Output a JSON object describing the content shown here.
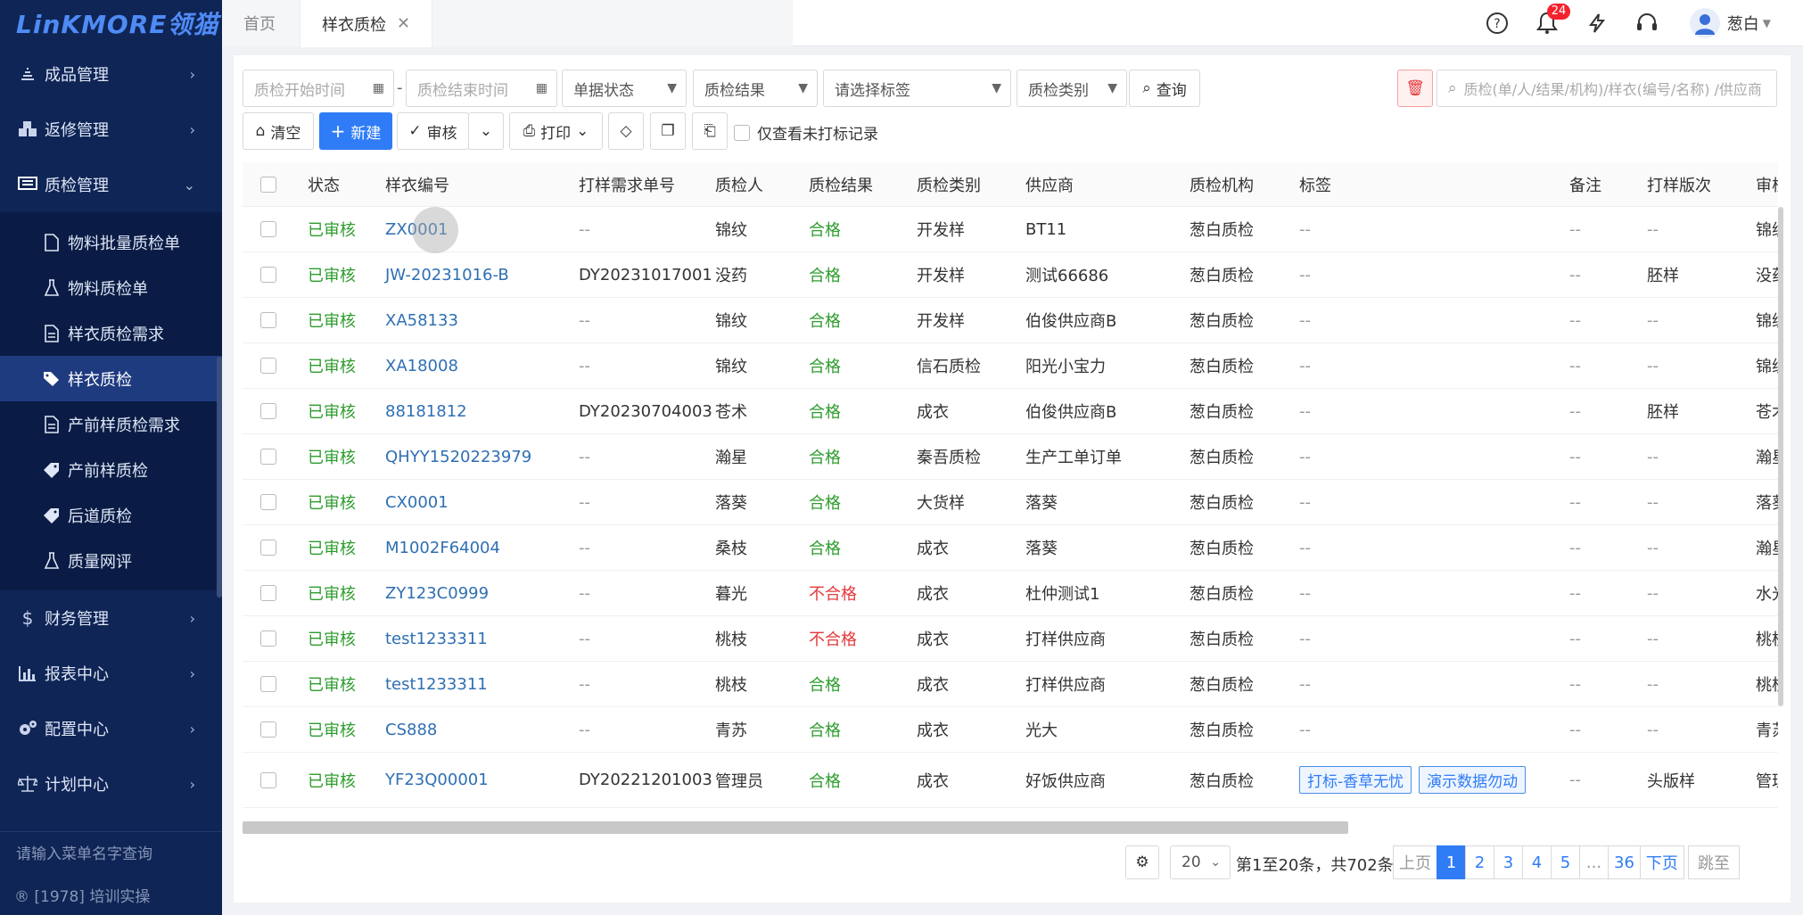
{
  "sidebar": {
    "logo": "LinKMORE领猫",
    "menu_top": [
      {
        "label": "成品管理",
        "icon": "stack-icon"
      },
      {
        "label": "返修管理",
        "icon": "cubes-icon"
      },
      {
        "label": "质检管理",
        "icon": "monitor-icon"
      }
    ],
    "submenu": [
      {
        "label": "物料批量质检单",
        "icon": "document-icon"
      },
      {
        "label": "物料质检单",
        "icon": "flask-icon"
      },
      {
        "label": "样衣质检需求",
        "icon": "document-list-icon"
      },
      {
        "label": "样衣质检",
        "icon": "tags-icon",
        "active": true
      },
      {
        "label": "产前样质检需求",
        "icon": "document-list-icon"
      },
      {
        "label": "产前样质检",
        "icon": "tag-icon"
      },
      {
        "label": "后道质检",
        "icon": "tag-icon"
      },
      {
        "label": "质量网评",
        "icon": "flask-icon"
      }
    ],
    "menu_bottom": [
      {
        "label": "财务管理",
        "icon": "dollar-icon"
      },
      {
        "label": "报表中心",
        "icon": "bar-chart-icon"
      },
      {
        "label": "配置中心",
        "icon": "gears-icon"
      },
      {
        "label": "计划中心",
        "icon": "scale-icon"
      }
    ],
    "menu_search_placeholder": "请输入菜单名字查询",
    "footer": "® [1978] 培训实操"
  },
  "header": {
    "tab_home": "首页",
    "tab_current": "样衣质检",
    "notification_count": "24",
    "username": "葱白"
  },
  "filters": {
    "start_time": "质检开始时间",
    "dash": "-",
    "end_time": "质检结束时间",
    "doc_status": "单据状态",
    "result": "质检结果",
    "tag": "请选择标签",
    "category": "质检类别",
    "query": "查询",
    "search_placeholder": "质检(单/人/结果/机构)/样衣(编号/名称) /供应商"
  },
  "toolbar": {
    "clear": "清空",
    "new": "新建",
    "review": "审核",
    "print": "打印",
    "unmarked_only": "仅查看未打标记录"
  },
  "table": {
    "columns": [
      "状态",
      "样衣编号",
      "打样需求单号",
      "质检人",
      "质检结果",
      "质检类别",
      "供应商",
      "质检机构",
      "标签",
      "备注",
      "打样版次",
      "审核"
    ],
    "rows": [
      {
        "status": "已审核",
        "code": "ZX0001",
        "req": "--",
        "inspector": "锦纹",
        "result": "合格",
        "category": "开发样",
        "supplier": "BT11",
        "org": "葱白质检",
        "tags": [
          "--"
        ],
        "note": "--",
        "version": "--",
        "reviewer": "锦纹"
      },
      {
        "status": "已审核",
        "code": "JW-20231016-B",
        "req": "DY20231017001",
        "inspector": "没药",
        "result": "合格",
        "category": "开发样",
        "supplier": "测试66686",
        "org": "葱白质检",
        "tags": [
          "--"
        ],
        "note": "--",
        "version": "胚样",
        "reviewer": "没药"
      },
      {
        "status": "已审核",
        "code": "XA58133",
        "req": "--",
        "inspector": "锦纹",
        "result": "合格",
        "category": "开发样",
        "supplier": "伯俊供应商B",
        "org": "葱白质检",
        "tags": [
          "--"
        ],
        "note": "--",
        "version": "--",
        "reviewer": "锦纹"
      },
      {
        "status": "已审核",
        "code": "XA18008",
        "req": "--",
        "inspector": "锦纹",
        "result": "合格",
        "category": "信石质检",
        "supplier": "阳光小宝力",
        "org": "葱白质检",
        "tags": [
          "--"
        ],
        "note": "--",
        "version": "--",
        "reviewer": "锦纹"
      },
      {
        "status": "已审核",
        "code": "88181812",
        "req": "DY20230704003",
        "inspector": "苍术",
        "result": "合格",
        "category": "成衣",
        "supplier": "伯俊供应商B",
        "org": "葱白质检",
        "tags": [
          "--"
        ],
        "note": "--",
        "version": "胚样",
        "reviewer": "苍术"
      },
      {
        "status": "已审核",
        "code": "QHYY1520223979",
        "req": "--",
        "inspector": "瀚星",
        "result": "合格",
        "category": "秦吾质检",
        "supplier": "生产工单订单",
        "org": "葱白质检",
        "tags": [
          "--"
        ],
        "note": "--",
        "version": "--",
        "reviewer": "瀚星"
      },
      {
        "status": "已审核",
        "code": "CX0001",
        "req": "--",
        "inspector": "落葵",
        "result": "合格",
        "category": "大货样",
        "supplier": "落葵",
        "org": "葱白质检",
        "tags": [
          "--"
        ],
        "note": "--",
        "version": "--",
        "reviewer": "落葵"
      },
      {
        "status": "已审核",
        "code": "M1002F64004",
        "req": "--",
        "inspector": "桑枝",
        "result": "合格",
        "category": "成衣",
        "supplier": "落葵",
        "org": "葱白质检",
        "tags": [
          "--"
        ],
        "note": "--",
        "version": "--",
        "reviewer": "瀚星"
      },
      {
        "status": "已审核",
        "code": "ZY123C0999",
        "req": "--",
        "inspector": "暮光",
        "result": "不合格",
        "category": "成衣",
        "supplier": "杜仲测试1",
        "org": "葱白质检",
        "tags": [
          "--"
        ],
        "note": "--",
        "version": "--",
        "reviewer": "水光"
      },
      {
        "status": "已审核",
        "code": "test1233311",
        "req": "--",
        "inspector": "桃枝",
        "result": "不合格",
        "category": "成衣",
        "supplier": "打样供应商",
        "org": "葱白质检",
        "tags": [
          "--"
        ],
        "note": "--",
        "version": "--",
        "reviewer": "桃枝"
      },
      {
        "status": "已审核",
        "code": "test1233311",
        "req": "--",
        "inspector": "桃枝",
        "result": "合格",
        "category": "成衣",
        "supplier": "打样供应商",
        "org": "葱白质检",
        "tags": [
          "--"
        ],
        "note": "--",
        "version": "--",
        "reviewer": "桃枝"
      },
      {
        "status": "已审核",
        "code": "CS888",
        "req": "--",
        "inspector": "青苏",
        "result": "合格",
        "category": "成衣",
        "supplier": "光大",
        "org": "葱白质检",
        "tags": [
          "--"
        ],
        "note": "--",
        "version": "--",
        "reviewer": "青苏"
      },
      {
        "status": "已审核",
        "code": "YF23Q00001",
        "req": "DY20221201003",
        "inspector": "管理员",
        "result": "合格",
        "category": "成衣",
        "supplier": "好饭供应商",
        "org": "葱白质检",
        "tags": [
          "打标-香草无忧",
          "演示数据勿动"
        ],
        "note": "--",
        "version": "头版样",
        "reviewer": "管理"
      }
    ]
  },
  "pagination": {
    "page_size": "20",
    "summary": "第1至20条，共702条",
    "prev": "上页",
    "pages": [
      "1",
      "2",
      "3",
      "4",
      "5",
      "...",
      "36"
    ],
    "next": "下页",
    "jump": "跳至"
  }
}
